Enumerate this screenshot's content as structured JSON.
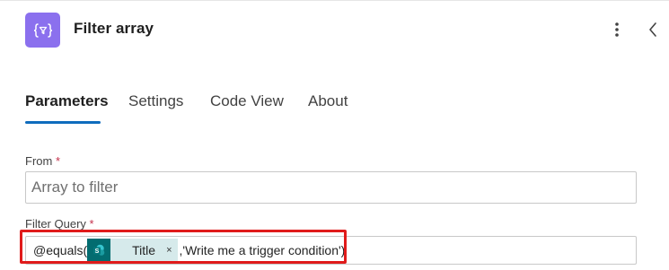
{
  "header": {
    "action_icon": "filter-array-icon",
    "title": "Filter array",
    "more_icon": "more-vertical-icon",
    "collapse_icon": "chevron-left-icon"
  },
  "tabs": [
    {
      "label": "Parameters",
      "active": true
    },
    {
      "label": "Settings",
      "active": false
    },
    {
      "label": "Code View",
      "active": false
    },
    {
      "label": "About",
      "active": false
    }
  ],
  "fields": {
    "from": {
      "label": "From",
      "required_mark": "*",
      "value": "",
      "placeholder": "Array to filter"
    },
    "filter_query": {
      "label": "Filter Query",
      "required_mark": "*",
      "prefix": "@equals(",
      "token": {
        "icon": "sharepoint-icon",
        "label": "Title",
        "remove": "×"
      },
      "suffix": ",'Write me a trigger condition')"
    }
  },
  "colors": {
    "action_icon_bg": "#8b70ee",
    "tab_accent": "#0f6cbd",
    "token_bg": "#d6eaeb",
    "sharepoint": "#036c70",
    "highlight_border": "#e01b1b",
    "required": "#c4314b"
  }
}
